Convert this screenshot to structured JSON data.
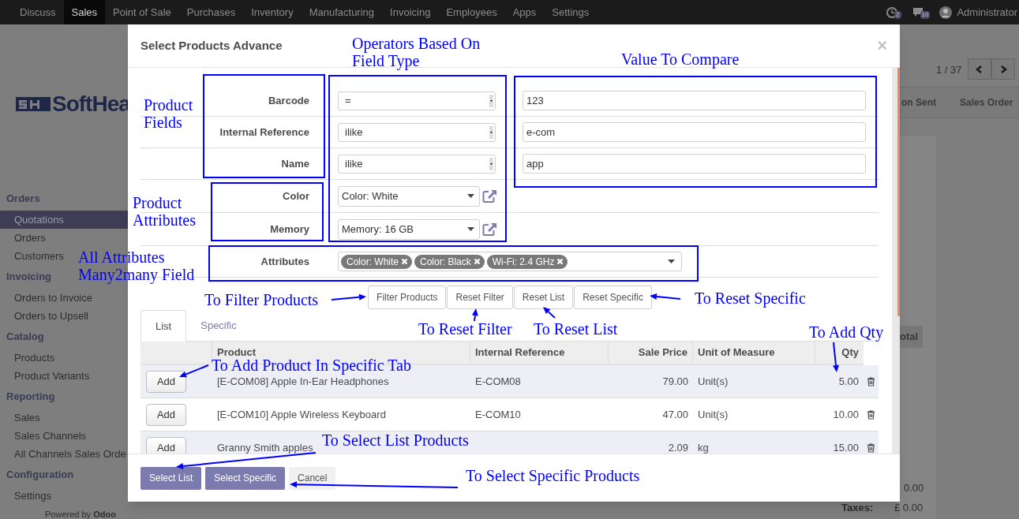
{
  "navbar": {
    "apps": [
      {
        "label": "Discuss",
        "selected": false
      },
      {
        "label": "Sales",
        "selected": true
      },
      {
        "label": "Point of Sale",
        "selected": false
      },
      {
        "label": "Purchases",
        "selected": false
      },
      {
        "label": "Inventory",
        "selected": false
      },
      {
        "label": "Manufacturing",
        "selected": false
      },
      {
        "label": "Invoicing",
        "selected": false
      },
      {
        "label": "Employees",
        "selected": false
      },
      {
        "label": "Apps",
        "selected": false
      },
      {
        "label": "Settings",
        "selected": false
      }
    ],
    "activity_count": "2",
    "message_count": "10",
    "user": "Administrator"
  },
  "background": {
    "logo": "SoftHea",
    "menu": [
      {
        "title": "Orders",
        "items": [
          {
            "label": "Quotations",
            "selected": true
          },
          {
            "label": "Orders",
            "selected": false
          },
          {
            "label": "Customers",
            "selected": false
          }
        ]
      },
      {
        "title": "Invoicing",
        "items": [
          {
            "label": "Orders to Invoice",
            "selected": false
          },
          {
            "label": "Orders to Upsell",
            "selected": false
          }
        ]
      },
      {
        "title": "Catalog",
        "items": [
          {
            "label": "Products",
            "selected": false
          },
          {
            "label": "Product Variants",
            "selected": false
          }
        ]
      },
      {
        "title": "Reporting",
        "items": [
          {
            "label": "Sales",
            "selected": false
          },
          {
            "label": "Sales Channels",
            "selected": false
          },
          {
            "label": "All Channels Sales Orde",
            "selected": false
          }
        ]
      },
      {
        "title": "Configuration",
        "items": [
          {
            "label": "Settings",
            "selected": false
          }
        ]
      }
    ],
    "pager": "1 / 37",
    "status_steps": [
      "on Sent",
      "Sales Order"
    ],
    "total_header": "otal",
    "untaxed_value": "0.00",
    "taxes_label": "Taxes:",
    "taxes_value": "£ 0.00",
    "footer": "Powered by **Odoo**"
  },
  "dialog": {
    "title": "Select Products Advance",
    "close": "×",
    "field_filters": [
      {
        "label": "Barcode",
        "operator": "=",
        "value": "123"
      },
      {
        "label": "Internal Reference",
        "operator": "ilike",
        "value": "e-com"
      },
      {
        "label": "Name",
        "operator": "ilike",
        "value": "app"
      }
    ],
    "attribute_filters": [
      {
        "label": "Color",
        "value": "Color: White"
      },
      {
        "label": "Memory",
        "value": "Memory: 16 GB"
      }
    ],
    "attributes": {
      "label": "Attributes",
      "tags": [
        "Color: White",
        "Color: Black",
        "Wi-Fi: 2.4 GHz"
      ]
    },
    "actions": [
      "Filter Products",
      "Reset Filter",
      "Reset List",
      "Reset Specific"
    ],
    "tabs": [
      {
        "label": "List",
        "selected": true
      },
      {
        "label": "Specific",
        "selected": false
      }
    ],
    "table": {
      "columns": [
        "Product",
        "Internal Reference",
        "Sale Price",
        "Unit of Measure",
        "Qty"
      ],
      "rows": [
        {
          "button": "Add",
          "cells": [
            "[E-COM08] Apple In-Ear Headphones",
            "E-COM08",
            "79.00",
            "Unit(s)",
            "5.00"
          ]
        },
        {
          "button": "Add",
          "cells": [
            "[E-COM10] Apple Wireless Keyboard",
            "E-COM10",
            "47.00",
            "Unit(s)",
            "10.00"
          ]
        },
        {
          "button": "Add",
          "cells": [
            "Granny Smith apples",
            "",
            "2.09",
            "kg",
            "15.00"
          ]
        }
      ]
    },
    "footer_buttons": [
      {
        "label": "Select List",
        "kind": "primary"
      },
      {
        "label": "Select Specific",
        "kind": "primary"
      },
      {
        "label": "Cancel",
        "kind": "secondary"
      }
    ]
  },
  "annotations": [
    {
      "text": "Operators Based On Field Type"
    },
    {
      "text": "Value To Compare"
    },
    {
      "text": "Product Fields"
    },
    {
      "text": "Product Attributes"
    },
    {
      "text": "All Attributes Many2many Field"
    },
    {
      "text": "To Filter Products"
    },
    {
      "text": "To Reset Specific"
    },
    {
      "text": "To Reset Filter"
    },
    {
      "text": "To Reset List"
    },
    {
      "text": "To Add Qty"
    },
    {
      "text": "To Add Product In Specific Tab"
    },
    {
      "text": "To Select List Products"
    },
    {
      "text": "To Select Specific Products"
    }
  ]
}
